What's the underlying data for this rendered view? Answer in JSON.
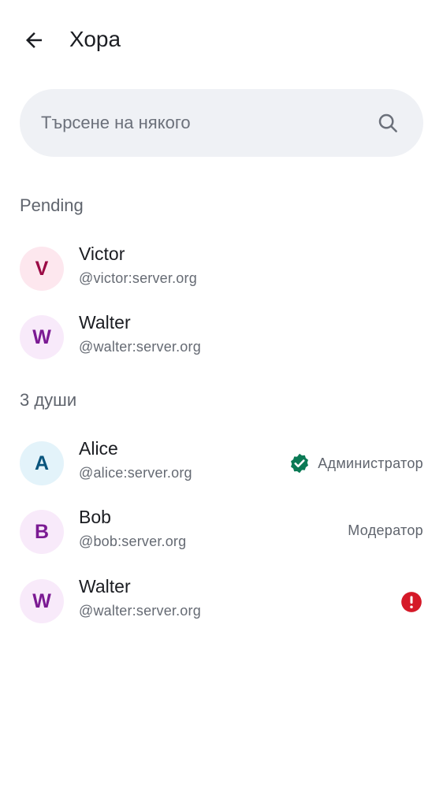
{
  "header": {
    "title": "Хора"
  },
  "search": {
    "placeholder": "Търсене на някого"
  },
  "pending": {
    "header": "Pending",
    "members": [
      {
        "initial": "V",
        "name": "Victor",
        "handle": "@victor:server.org",
        "avatar_bg": "#fde7ee",
        "avatar_fg": "#9b0a45"
      },
      {
        "initial": "W",
        "name": "Walter",
        "handle": "@walter:server.org",
        "avatar_bg": "#f8eafa",
        "avatar_fg": "#7b1a93"
      }
    ]
  },
  "joined": {
    "header": "3 души",
    "members": [
      {
        "initial": "A",
        "name": "Alice",
        "handle": "@alice:server.org",
        "role": "Администратор",
        "role_icon": "verified-badge-icon",
        "avatar_bg": "#e3f3fa",
        "avatar_fg": "#0a557d"
      },
      {
        "initial": "B",
        "name": "Bob",
        "handle": "@bob:server.org",
        "role": "Модератор",
        "avatar_bg": "#f8eafa",
        "avatar_fg": "#7b1a93"
      },
      {
        "initial": "W",
        "name": "Walter",
        "handle": "@walter:server.org",
        "status_icon": "error-icon",
        "avatar_bg": "#f8eafa",
        "avatar_fg": "#7b1a93"
      }
    ]
  },
  "colors": {
    "verified": "#0b7a55",
    "error": "#d51928"
  }
}
